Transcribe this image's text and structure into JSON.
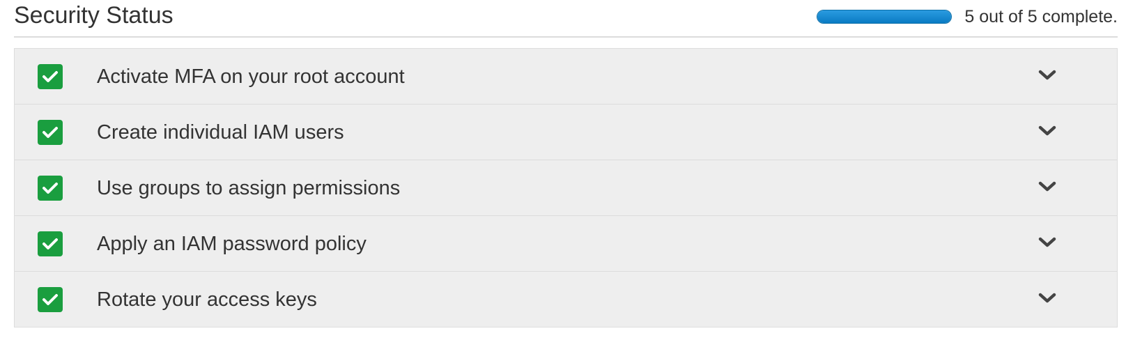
{
  "header": {
    "title": "Security Status",
    "progress": {
      "fraction": 1.0,
      "text": "5 out of 5 complete."
    }
  },
  "colors": {
    "check_bg": "#1a9e3f",
    "progress_fill": "#0a7bc4"
  },
  "items": [
    {
      "label": "Activate MFA on your root account",
      "status_icon": "checkbox-checked-icon",
      "expand_icon": "chevron-down-icon"
    },
    {
      "label": "Create individual IAM users",
      "status_icon": "checkbox-checked-icon",
      "expand_icon": "chevron-down-icon"
    },
    {
      "label": "Use groups to assign permissions",
      "status_icon": "checkbox-checked-icon",
      "expand_icon": "chevron-down-icon"
    },
    {
      "label": "Apply an IAM password policy",
      "status_icon": "checkbox-checked-icon",
      "expand_icon": "chevron-down-icon"
    },
    {
      "label": "Rotate your access keys",
      "status_icon": "checkbox-checked-icon",
      "expand_icon": "chevron-down-icon"
    }
  ]
}
